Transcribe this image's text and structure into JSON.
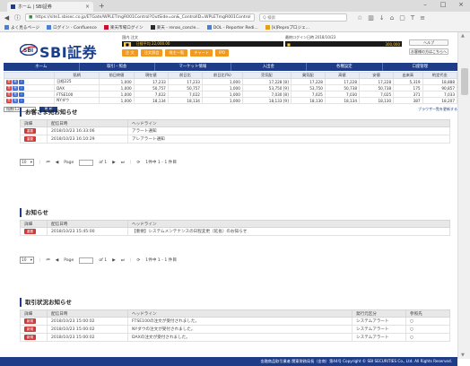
{
  "browser": {
    "tab_title": "ホーム | SBI証券",
    "url": "https://site1.sbisec.co.jp/ETGate/WPLETmgR001Control?OutSide=on&_ControlID=WPLETmgR001Control",
    "search_placeholder": "Q 検索",
    "bookmarks": [
      {
        "label": "よく見るページ"
      },
      {
        "label": "ログイン - Confluence"
      },
      {
        "label": "楽天市場ログイン"
      },
      {
        "label": "楽天 - renas_concle..."
      },
      {
        "label": "DOL - Reporter Redi..."
      },
      {
        "label": "[k]Reproプロジェ..."
      }
    ]
  },
  "header": {
    "logo_text": "SBI証券",
    "market_label": "国内 注文",
    "market_status": "日経平均 22,000.00",
    "tabs": [
      {
        "label": "注 文"
      },
      {
        "label": "注文照会"
      },
      {
        "label": "株主一覧"
      },
      {
        "label": "チャート"
      },
      {
        "label": "IPO"
      }
    ],
    "right_label": "最終ログイン日時 2018/10/23",
    "right_value": "300,000",
    "help_buttons": [
      {
        "label": "ヘルプ"
      },
      {
        "label": "お客様の方はこちらへ"
      }
    ]
  },
  "main_nav": [
    {
      "label": "ホーム"
    },
    {
      "label": "取引・照会"
    },
    {
      "label": "マーケット情報"
    },
    {
      "label": "入出金"
    },
    {
      "label": "各種設定"
    },
    {
      "label": "口座管理"
    }
  ],
  "portfolio": {
    "columns": [
      "",
      "銘柄",
      "前日終値",
      "現在値",
      "前日比",
      "前日比(%)",
      "売気配",
      "買気配",
      "高値",
      "安値",
      "出来高",
      "約定代金"
    ],
    "rows": [
      {
        "name": "日経225",
        "prev": "1,000",
        "now": "17,233",
        "chg": "17,233",
        "pct": "1,000",
        "ask": "17,228 [8]",
        "bid": "17,228",
        "hi": "17,228",
        "lo": "17,228",
        "vol": "5,319",
        "amt": "18,888",
        "dir": "neg"
      },
      {
        "name": "DAX",
        "prev": "1,000",
        "now": "50,757",
        "chg": "50,757",
        "pct": "1,000",
        "ask": "53,750 [9]",
        "bid": "53,750",
        "hi": "50,738",
        "lo": "50,738",
        "vol": "175",
        "amt": "90,857",
        "dir": "neg"
      },
      {
        "name": "FTSE100",
        "prev": "1,000",
        "now": "7,022",
        "chg": "7,022",
        "pct": "1,000",
        "ask": "7,030 [8]",
        "bid": "7,025",
        "hi": "7,030",
        "lo": "7,025",
        "vol": "371",
        "amt": "7,033",
        "dir": "neg"
      },
      {
        "name": "NYダウ",
        "prev": "1,000",
        "now": "18,134",
        "chg": "18,134",
        "pct": "1,000",
        "ask": "18,133 [9]",
        "bid": "18,130",
        "hi": "18,134",
        "lo": "18,130",
        "vol": "387",
        "amt": "18,207",
        "dir": "pos"
      }
    ],
    "select_value": "指数(12)",
    "update_button": "更 新",
    "link": "ブラウザ一覧を更新する"
  },
  "sections": [
    {
      "title": "お客さま宛お知らせ",
      "columns": [
        "詳細",
        "配信日時",
        "ヘッドライン"
      ],
      "rows": [
        {
          "badge": "重要",
          "date": "2018/10/23 16:33:06",
          "headline": "アラート通知"
        },
        {
          "badge": "重要",
          "date": "2018/10/23 16:10:29",
          "headline": "アレアラート通知"
        }
      ],
      "pager": {
        "per_page": "10",
        "page_label": "Page",
        "of": "of 1",
        "count": "1件中 1 - 1 件目"
      }
    },
    {
      "title": "お知らせ",
      "columns": [
        "詳細",
        "配信日時",
        "ヘッドライン"
      ],
      "rows": [
        {
          "badge": "重要",
          "date": "2018/10/23 15:45:00",
          "headline": "【重要】システムメンテナンスの日程変更（延長）のお知らせ"
        }
      ],
      "pager": {
        "per_page": "10",
        "page_label": "Page",
        "of": "of 1",
        "count": "1件中 1 - 1 件目"
      }
    },
    {
      "title": "取引状況お知らせ",
      "columns": [
        "詳細",
        "配信日時",
        "ヘッドライン",
        "発行元区分",
        "参照先"
      ],
      "rows": [
        {
          "badge": "新規",
          "date": "2018/10/23 15:00:02",
          "headline": "FTSE100の注文が受付されました。",
          "source": "システムアラート",
          "ref": "○"
        },
        {
          "badge": "新規",
          "date": "2018/10/23 15:00:02",
          "headline": "NYダウの注文が受付されました。",
          "source": "システムアラート",
          "ref": "○"
        },
        {
          "badge": "新規",
          "date": "2018/10/23 15:00:02",
          "headline": "DAXの注文が受付されました。",
          "source": "システムアラート",
          "ref": "○"
        }
      ]
    }
  ],
  "footer": "金融商品取引業者 関東財務局長（金商）第44号  Copyright © SBI SECURITIES Co., Ltd. All Rights Reserved."
}
